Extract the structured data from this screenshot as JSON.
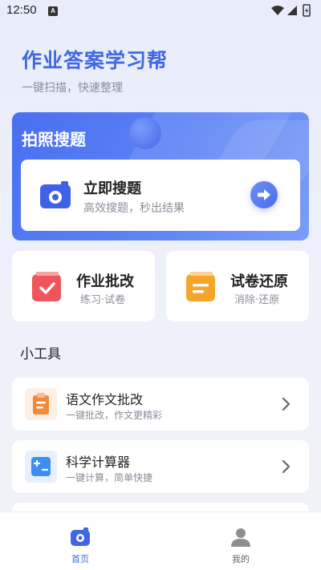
{
  "status_bar": {
    "time": "12:50",
    "notification_letter": "A"
  },
  "header": {
    "title": "作业答案学习帮",
    "subtitle": "一键扫描，快速整理"
  },
  "hero": {
    "title": "拍照搜题",
    "action_title": "立即搜题",
    "action_subtitle": "高效搜题，秒出结果",
    "icon": "camera-icon",
    "arrow_icon": "arrow-right-icon"
  },
  "cards": [
    {
      "title": "作业批改",
      "subtitle": "练习·试卷",
      "icon": "check-list-icon",
      "color": "#f0555b"
    },
    {
      "title": "试卷还原",
      "subtitle": "消除·还原",
      "icon": "document-icon",
      "color": "#f7a42b"
    }
  ],
  "tools_section": {
    "title": "小工具"
  },
  "tools": [
    {
      "title": "语文作文批改",
      "subtitle": "一键批改，作文更精彩",
      "icon": "clipboard-icon",
      "color": "#f38a3a"
    },
    {
      "title": "科学计算器",
      "subtitle": "一键计算，简单快捷",
      "icon": "calculator-icon",
      "color": "#3e8ef2"
    }
  ],
  "bottom_nav": [
    {
      "label": "首页",
      "icon": "camera-home-icon",
      "active": true
    },
    {
      "label": "我的",
      "icon": "user-icon",
      "active": false
    }
  ],
  "colors": {
    "accent": "#3f68e2",
    "background": "#eef1fa"
  }
}
